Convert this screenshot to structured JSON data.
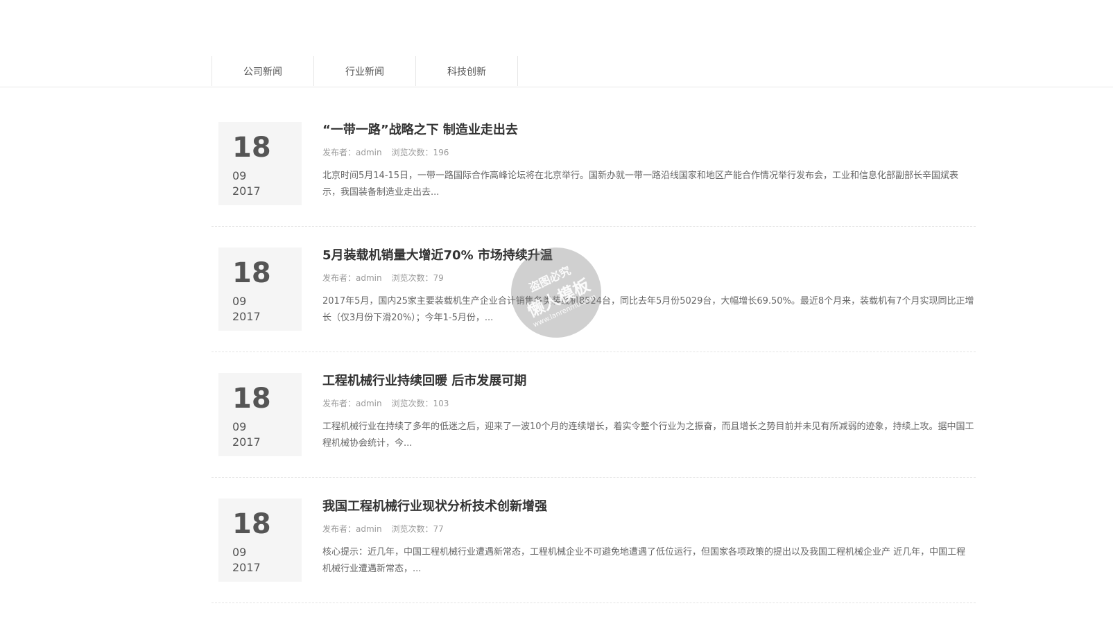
{
  "tabs": [
    {
      "label": "公司新闻"
    },
    {
      "label": "行业新闻"
    },
    {
      "label": "科技创新"
    }
  ],
  "news": [
    {
      "day": "18",
      "month": "09",
      "year": "2017",
      "title": "“一带一路”战略之下 制造业走出去",
      "author": "发布者：admin",
      "views": "浏览次数：196",
      "summary": "北京时间5月14-15日，一带一路国际合作高峰论坛将在北京举行。国新办就一带一路沿线国家和地区产能合作情况举行发布会，工业和信息化部副部长辛国斌表示，我国装备制造业走出去..."
    },
    {
      "day": "18",
      "month": "09",
      "year": "2017",
      "title": "5月装载机销量大增近70% 市场持续升温",
      "author": "发布者：admin",
      "views": "浏览次数：79",
      "summary": "2017年5月，国内25家主要装载机生产企业合计销售各类装载机8524台，同比去年5月份5029台，大幅增长69.50%。最近8个月来，装载机有7个月实现同比正增长（仅3月份下滑20%）；今年1-5月份，..."
    },
    {
      "day": "18",
      "month": "09",
      "year": "2017",
      "title": "工程机械行业持续回暖 后市发展可期",
      "author": "发布者：admin",
      "views": "浏览次数：103",
      "summary": "工程机械行业在持续了多年的低迷之后，迎来了一波10个月的连续增长，着实令整个行业为之振奋，而且增长之势目前并未见有所减弱的迹象，持续上攻。据中国工程机械协会统计，今..."
    },
    {
      "day": "18",
      "month": "09",
      "year": "2017",
      "title": "我国工程机械行业现状分析技术创新增强",
      "author": "发布者：admin",
      "views": "浏览次数：77",
      "summary": "核心提示：近几年，中国工程机械行业遭遇新常态，工程机械企业不可避免地遭遇了低位运行，但国家各项政策的提出以及我国工程机械企业产 近几年，中国工程机械行业遭遇新常态，..."
    }
  ],
  "watermark": {
    "line1": "盗图必究",
    "line2": "懒人模板",
    "line3": "www.lanrenmb.com"
  }
}
